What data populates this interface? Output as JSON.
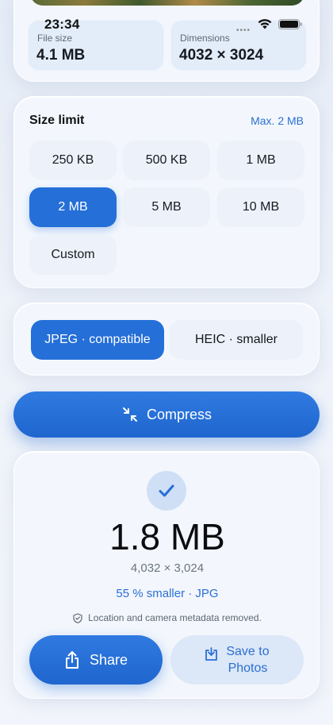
{
  "status_bar": {
    "time": "23:34"
  },
  "image_info": {
    "file_size_label": "File size",
    "file_size_value": "4.1 MB",
    "dimensions_label": "Dimensions",
    "dimensions_value": "4032 × 3024"
  },
  "size_limit": {
    "title": "Size limit",
    "max_label": "Max. 2 MB",
    "options": [
      {
        "label": "250 KB",
        "selected": false
      },
      {
        "label": "500 KB",
        "selected": false
      },
      {
        "label": "1 MB",
        "selected": false
      },
      {
        "label": "2 MB",
        "selected": true
      },
      {
        "label": "5 MB",
        "selected": false
      },
      {
        "label": "10 MB",
        "selected": false
      },
      {
        "label": "Custom",
        "selected": false
      }
    ]
  },
  "format": {
    "options": [
      {
        "label": "JPEG · compatible",
        "selected": true
      },
      {
        "label": "HEIC · smaller",
        "selected": false
      }
    ]
  },
  "compress_button": {
    "label": "Compress"
  },
  "result": {
    "size": "1.8 MB",
    "dimensions": "4,032 × 3,024",
    "savings": "55 % smaller · JPG",
    "metadata_note": "Location and camera metadata removed."
  },
  "actions": {
    "share_label": "Share",
    "save_line1": "Save to",
    "save_line2": "Photos"
  },
  "colors": {
    "accent": "#256fd8",
    "card_bg": "#f3f7fd"
  },
  "icons": [
    "wifi-icon",
    "battery-icon",
    "compress-arrows-icon",
    "checkmark-icon",
    "shield-icon",
    "share-icon",
    "download-icon"
  ]
}
